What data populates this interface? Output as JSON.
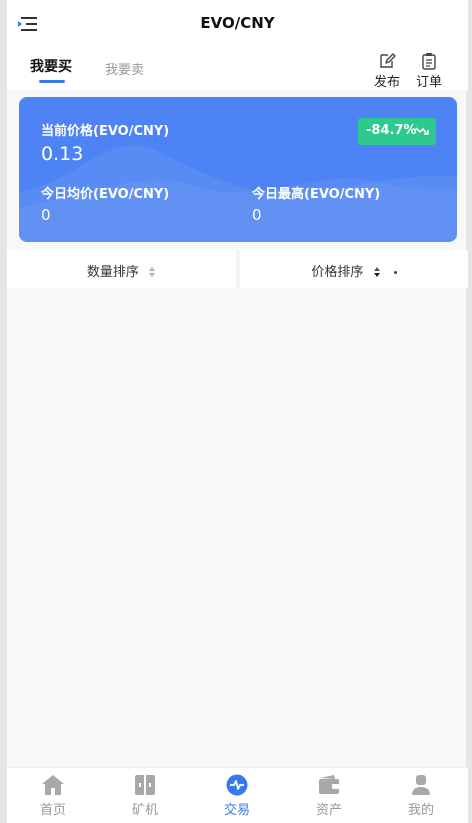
{
  "header": {
    "title": "EVO/CNY"
  },
  "tabs": {
    "buy_label": "我要买",
    "sell_label": "我要卖"
  },
  "actions": {
    "publish_label": "发布",
    "orders_label": "订单"
  },
  "price_card": {
    "current_label": "当前价格(EVO/CNY)",
    "current_value": "0.13",
    "change_badge": "-84.7%",
    "avg_label": "今日均价(EVO/CNY)",
    "avg_value": "0",
    "high_label": "今日最高(EVO/CNY)",
    "high_value": "0"
  },
  "sort": {
    "quantity_label": "数量排序",
    "price_label": "价格排序"
  },
  "tabbar": {
    "items": [
      {
        "label": "首页",
        "icon": "home-icon"
      },
      {
        "label": "矿机",
        "icon": "miner-icon"
      },
      {
        "label": "交易",
        "icon": "trade-icon"
      },
      {
        "label": "资产",
        "icon": "wallet-icon"
      },
      {
        "label": "我的",
        "icon": "user-icon"
      }
    ],
    "active_index": 2
  },
  "colors": {
    "accent": "#3a78ef",
    "card_bg": "#4d83f4",
    "badge_bg": "#2dc98f",
    "inactive": "#999999"
  }
}
